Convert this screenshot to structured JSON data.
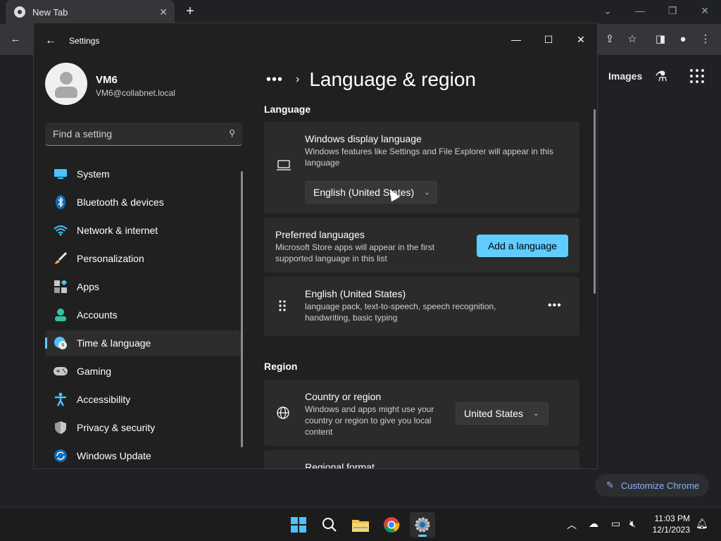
{
  "chrome": {
    "tab_title": "New Tab",
    "tab_close": "✕",
    "new_tab": "+",
    "images_link": "Images",
    "customize_label": "Customize Chrome"
  },
  "settings": {
    "app_title": "Settings",
    "profile": {
      "name": "VM6",
      "email": "VM6@collabnet.local"
    },
    "search": {
      "placeholder": "Find a setting"
    },
    "nav": [
      {
        "label": "System",
        "icon": "system-icon"
      },
      {
        "label": "Bluetooth & devices",
        "icon": "bluetooth-icon"
      },
      {
        "label": "Network & internet",
        "icon": "wifi-icon"
      },
      {
        "label": "Personalization",
        "icon": "brush-icon"
      },
      {
        "label": "Apps",
        "icon": "apps-icon"
      },
      {
        "label": "Accounts",
        "icon": "account-icon"
      },
      {
        "label": "Time & language",
        "icon": "globe-clock-icon",
        "active": true
      },
      {
        "label": "Gaming",
        "icon": "gamepad-icon"
      },
      {
        "label": "Accessibility",
        "icon": "accessibility-icon"
      },
      {
        "label": "Privacy & security",
        "icon": "shield-icon"
      },
      {
        "label": "Windows Update",
        "icon": "update-icon"
      }
    ],
    "breadcrumb": {
      "more": "•••",
      "chevron": "›",
      "title": "Language & region"
    },
    "language_section": "Language",
    "display_language": {
      "title": "Windows display language",
      "desc": "Windows features like Settings and File Explorer will appear in this language",
      "value": "English (United States)"
    },
    "preferred_languages": {
      "title": "Preferred languages",
      "desc": "Microsoft Store apps will appear in the first supported language in this list",
      "button": "Add a language"
    },
    "language_item": {
      "title": "English (United States)",
      "desc": "language pack, text-to-speech, speech recognition, handwriting, basic typing",
      "more": "•••"
    },
    "region_section": "Region",
    "country": {
      "title": "Country or region",
      "desc": "Windows and apps might use your country or region to give you local content",
      "value": "United States"
    },
    "regional_format": {
      "title": "Regional format"
    }
  },
  "taskbar": {
    "time": "11:03 PM",
    "date": "12/1/2023"
  }
}
